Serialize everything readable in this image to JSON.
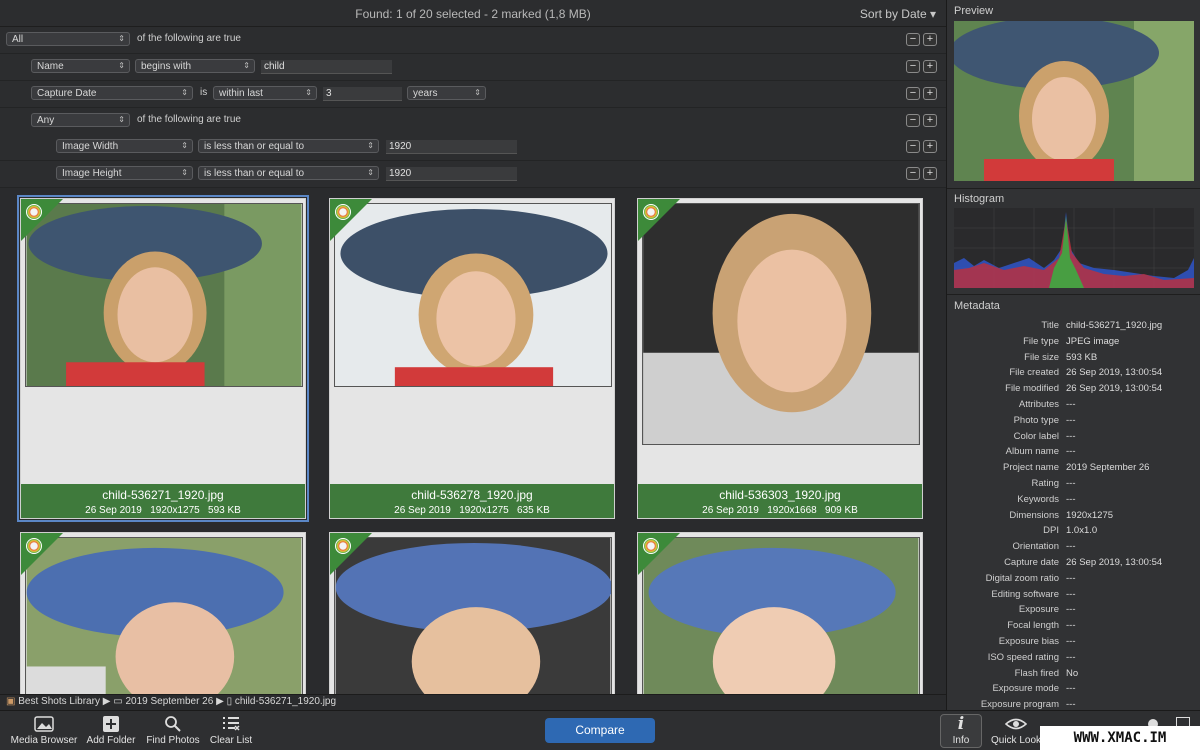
{
  "header": {
    "found": "Found: 1 of 20 selected - 2 marked (1,8 MB)",
    "sort": "Sort by Date"
  },
  "filters": {
    "row1": {
      "quantifier": "All",
      "text": "of the following are true"
    },
    "row2": {
      "field": "Name",
      "op": "begins with",
      "value": "child"
    },
    "row3": {
      "field": "Capture Date",
      "is": "is",
      "op": "within last",
      "value": "3",
      "unit": "years"
    },
    "row4": {
      "quantifier": "Any",
      "text": "of the following are true"
    },
    "row5": {
      "field": "Image Width",
      "op": "is less than or equal to",
      "value": "1920"
    },
    "row6": {
      "field": "Image Height",
      "op": "is less than or equal to",
      "value": "1920"
    },
    "minus": "−",
    "plus": "+"
  },
  "photos": [
    {
      "name": "child-536271_1920.jpg",
      "date": "26 Sep 2019",
      "dims": "1920x1275",
      "size": "593 KB"
    },
    {
      "name": "child-536278_1920.jpg",
      "date": "26 Sep 2019",
      "dims": "1920x1275",
      "size": "635 KB"
    },
    {
      "name": "child-536303_1920.jpg",
      "date": "26 Sep 2019",
      "dims": "1920x1668",
      "size": "909 KB"
    }
  ],
  "path": {
    "library": "Best Shots Library",
    "folder": "2019 September 26",
    "file": "child-536271_1920.jpg"
  },
  "toolbar": {
    "media": "Media Browser",
    "add": "Add Folder",
    "find": "Find Photos",
    "clear": "Clear List",
    "compare": "Compare",
    "info": "Info",
    "quick": "Quick Look"
  },
  "panel": {
    "preview": "Preview",
    "histogram": "Histogram",
    "metadata": "Metadata"
  },
  "metadata": [
    {
      "k": "Title",
      "v": "child-536271_1920.jpg"
    },
    {
      "k": "File type",
      "v": "JPEG image"
    },
    {
      "k": "File size",
      "v": "593 KB"
    },
    {
      "k": "File created",
      "v": "26 Sep 2019, 13:00:54"
    },
    {
      "k": "File modified",
      "v": "26 Sep 2019, 13:00:54"
    },
    {
      "k": "Attributes",
      "v": "---"
    },
    {
      "k": "Photo type",
      "v": "---"
    },
    {
      "k": "Color label",
      "v": "---"
    },
    {
      "k": "Album name",
      "v": "---"
    },
    {
      "k": "Project name",
      "v": "2019 September 26"
    },
    {
      "k": "Rating",
      "v": "---"
    },
    {
      "k": "Keywords",
      "v": "---"
    },
    {
      "k": "Dimensions",
      "v": "1920x1275"
    },
    {
      "k": "DPI",
      "v": "1.0x1.0"
    },
    {
      "k": "Orientation",
      "v": "---"
    },
    {
      "k": "Capture date",
      "v": "26 Sep 2019, 13:00:54"
    },
    {
      "k": "Digital zoom ratio",
      "v": "---"
    },
    {
      "k": "Editing software",
      "v": "---"
    },
    {
      "k": "Exposure",
      "v": "---"
    },
    {
      "k": "Focal length",
      "v": "---"
    },
    {
      "k": "Exposure bias",
      "v": "---"
    },
    {
      "k": "ISO speed rating",
      "v": "---"
    },
    {
      "k": "Flash fired",
      "v": "No"
    },
    {
      "k": "Exposure mode",
      "v": "---"
    },
    {
      "k": "Exposure program",
      "v": "---"
    }
  ],
  "watermark": "WWW.XMAC.IM"
}
